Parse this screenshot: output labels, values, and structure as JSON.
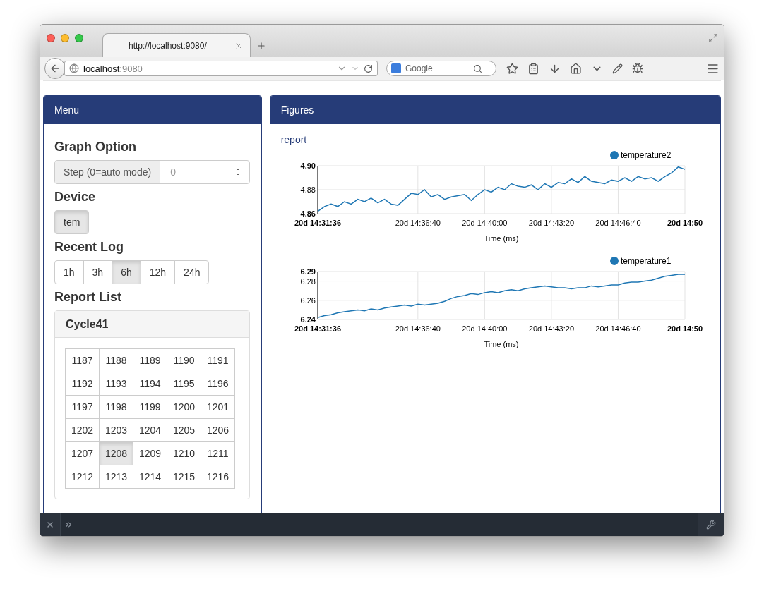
{
  "browser": {
    "tab": {
      "title": "http://localhost:9080/"
    },
    "url": {
      "host": "localhost",
      "port": ":9080"
    },
    "search": {
      "placeholder": "Google"
    }
  },
  "menu": {
    "title": "Menu",
    "graph_option": {
      "heading": "Graph Option",
      "addon": "Step (0=auto mode)",
      "placeholder": "0"
    },
    "device": {
      "heading": "Device",
      "buttons": [
        {
          "label": "tem",
          "selected": true
        }
      ]
    },
    "recent_log": {
      "heading": "Recent Log",
      "buttons": [
        {
          "label": "1h",
          "selected": false
        },
        {
          "label": "3h",
          "selected": false
        },
        {
          "label": "6h",
          "selected": true
        },
        {
          "label": "12h",
          "selected": false
        },
        {
          "label": "24h",
          "selected": false
        }
      ]
    },
    "report_list": {
      "heading": "Report List",
      "panel_title": "Cycle41",
      "cells": [
        {
          "label": "1187",
          "selected": false
        },
        {
          "label": "1188",
          "selected": false
        },
        {
          "label": "1189",
          "selected": false
        },
        {
          "label": "1190",
          "selected": false
        },
        {
          "label": "1191",
          "selected": false
        },
        {
          "label": "1192",
          "selected": false
        },
        {
          "label": "1193",
          "selected": false
        },
        {
          "label": "1194",
          "selected": false
        },
        {
          "label": "1195",
          "selected": false
        },
        {
          "label": "1196",
          "selected": false
        },
        {
          "label": "1197",
          "selected": false
        },
        {
          "label": "1198",
          "selected": false
        },
        {
          "label": "1199",
          "selected": false
        },
        {
          "label": "1200",
          "selected": false
        },
        {
          "label": "1201",
          "selected": false
        },
        {
          "label": "1202",
          "selected": false
        },
        {
          "label": "1203",
          "selected": false
        },
        {
          "label": "1204",
          "selected": false
        },
        {
          "label": "1205",
          "selected": false
        },
        {
          "label": "1206",
          "selected": false
        },
        {
          "label": "1207",
          "selected": false
        },
        {
          "label": "1208",
          "selected": true
        },
        {
          "label": "1209",
          "selected": false
        },
        {
          "label": "1210",
          "selected": false
        },
        {
          "label": "1211",
          "selected": false
        },
        {
          "label": "1212",
          "selected": false
        },
        {
          "label": "1213",
          "selected": false
        },
        {
          "label": "1214",
          "selected": false
        },
        {
          "label": "1215",
          "selected": false
        },
        {
          "label": "1216",
          "selected": false
        }
      ]
    }
  },
  "figures": {
    "title": "Figures",
    "link": "report",
    "charts": [
      {
        "chart_data": {
          "type": "line",
          "xlabel": "Time (ms)",
          "categories": [
            "20d 14:31:36",
            null,
            null,
            null,
            null,
            null,
            null,
            null,
            null,
            null,
            null,
            null,
            null,
            null,
            null,
            "20d 14:36:40",
            null,
            null,
            null,
            null,
            null,
            null,
            null,
            null,
            null,
            "20d 14:40:00",
            null,
            null,
            null,
            null,
            null,
            null,
            null,
            null,
            null,
            "20d 14:43:20",
            null,
            null,
            null,
            null,
            null,
            null,
            null,
            null,
            null,
            "20d 14:46:40",
            null,
            null,
            null,
            null,
            null,
            null,
            null,
            null,
            null,
            "20d 14:50"
          ],
          "series": [
            {
              "name": "temperature2",
              "color": "#1f77b4",
              "values": [
                4.862,
                4.866,
                4.868,
                4.866,
                4.87,
                4.868,
                4.872,
                4.87,
                4.873,
                4.869,
                4.872,
                4.868,
                4.867,
                4.872,
                4.877,
                4.876,
                4.88,
                4.874,
                4.876,
                4.872,
                4.874,
                4.875,
                4.876,
                4.871,
                4.876,
                4.88,
                4.878,
                4.882,
                4.88,
                4.885,
                4.883,
                4.882,
                4.884,
                4.88,
                4.885,
                4.882,
                4.886,
                4.885,
                4.889,
                4.886,
                4.891,
                4.887,
                4.886,
                4.885,
                4.888,
                4.887,
                4.89,
                4.887,
                4.891,
                4.889,
                4.89,
                4.887,
                4.891,
                4.894,
                4.899,
                4.897
              ]
            }
          ],
          "grid": true,
          "ylim": [
            4.86,
            4.9
          ],
          "yticks": [
            4.86,
            4.88,
            {
              "value": 4.9,
              "label": "4.90"
            }
          ]
        }
      },
      {
        "chart_data": {
          "type": "line",
          "xlabel": "Time (ms)",
          "categories": [
            "20d 14:31:36",
            null,
            null,
            null,
            null,
            null,
            null,
            null,
            null,
            null,
            null,
            null,
            null,
            null,
            null,
            "20d 14:36:40",
            null,
            null,
            null,
            null,
            null,
            null,
            null,
            null,
            null,
            "20d 14:40:00",
            null,
            null,
            null,
            null,
            null,
            null,
            null,
            null,
            null,
            "20d 14:43:20",
            null,
            null,
            null,
            null,
            null,
            null,
            null,
            null,
            null,
            "20d 14:46:40",
            null,
            null,
            null,
            null,
            null,
            null,
            null,
            null,
            null,
            "20d 14:50"
          ],
          "series": [
            {
              "name": "temperature1",
              "color": "#1f77b4",
              "values": [
                6.242,
                6.244,
                6.245,
                6.247,
                6.248,
                6.249,
                6.25,
                6.249,
                6.251,
                6.25,
                6.252,
                6.253,
                6.254,
                6.255,
                6.254,
                6.256,
                6.255,
                6.256,
                6.257,
                6.259,
                6.262,
                6.264,
                6.265,
                6.267,
                6.266,
                6.268,
                6.269,
                6.268,
                6.27,
                6.271,
                6.27,
                6.272,
                6.273,
                6.274,
                6.275,
                6.274,
                6.273,
                6.273,
                6.272,
                6.273,
                6.273,
                6.275,
                6.274,
                6.275,
                6.276,
                6.276,
                6.278,
                6.279,
                6.279,
                6.28,
                6.281,
                6.283,
                6.285,
                6.286,
                6.287,
                6.287
              ]
            }
          ],
          "grid": true,
          "ylim": [
            6.24,
            6.29
          ],
          "yticks": [
            6.24,
            6.26,
            6.28,
            6.29
          ]
        }
      }
    ]
  }
}
